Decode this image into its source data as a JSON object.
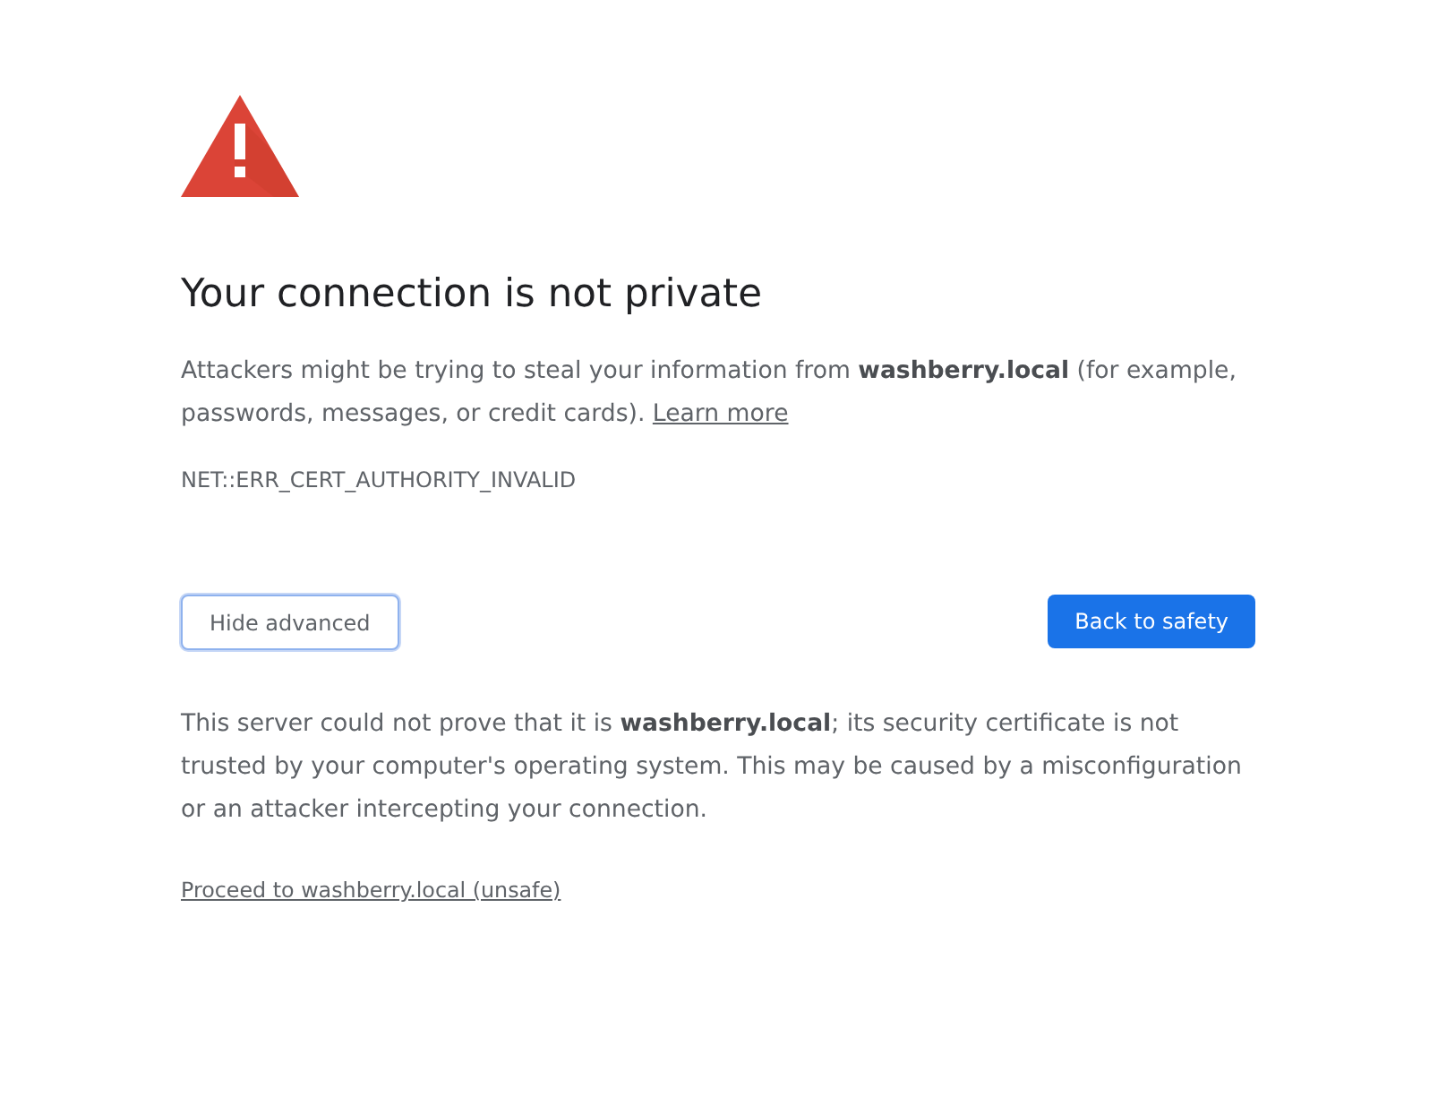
{
  "heading": "Your connection is not private",
  "intro": {
    "text": "Attackers might be trying to steal your information from **washberry.local** (for example, passwords, messages, or credit cards).",
    "link": "Learn more"
  },
  "error_code": "NET::ERR_CERT_AUTHORITY_INVALID",
  "buttons": [
    {
      "label": "Hide advanced",
      "kind": "secondary"
    },
    {
      "label": "Back to safety",
      "kind": "primary"
    }
  ],
  "details": {
    "text": "This server could not prove that it is **washberry.local**; its security certificate is not trusted by your computer's operating system. This may be caused by a misconfiguration or an attacker intercepting your connection.",
    "link": "Proceed to washberry.local (unsafe)"
  }
}
